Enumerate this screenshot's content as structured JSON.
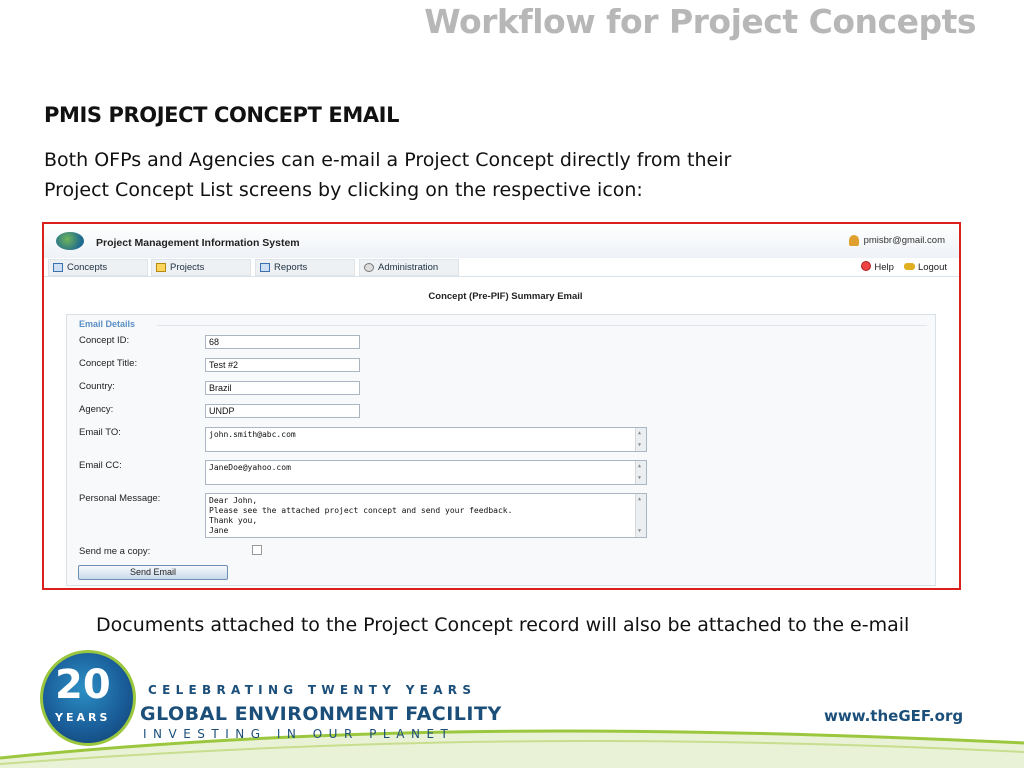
{
  "slide": {
    "title": "Workflow for Project Concepts",
    "heading": "PMIS PROJECT CONCEPT EMAIL",
    "intro_lines": [
      "Both OFPs and Agencies can e-mail a Project Concept directly from their",
      "Project Concept List screens by clicking on the respective icon:"
    ],
    "footer_note": "Documents attached to the Project Concept record will also be attached to the e-mail"
  },
  "app": {
    "title": "Project Management Information System",
    "user_email": "pmisbr@gmail.com",
    "tabs": [
      {
        "label": "Concepts",
        "icon": "concepts-icon"
      },
      {
        "label": "Projects",
        "icon": "projects-icon"
      },
      {
        "label": "Reports",
        "icon": "reports-icon"
      },
      {
        "label": "Administration",
        "icon": "gear-icon"
      }
    ],
    "help_label": "Help",
    "logout_label": "Logout",
    "page_heading": "Concept (Pre-PIF) Summary Email",
    "form": {
      "legend": "Email Details",
      "concept_id": {
        "label": "Concept ID:",
        "value": "68"
      },
      "concept_title": {
        "label": "Concept Title:",
        "value": "Test #2"
      },
      "country": {
        "label": "Country:",
        "value": "Brazil"
      },
      "agency": {
        "label": "Agency:",
        "value": "UNDP"
      },
      "email_to": {
        "label": "Email TO:",
        "value": "john.smith@abc.com"
      },
      "email_cc": {
        "label": "Email CC:",
        "value": "JaneDoe@yahoo.com"
      },
      "personal_message": {
        "label": "Personal Message:",
        "lines": [
          "Dear John,",
          "Please see the attached project concept and send your feedback.",
          "Thank you,",
          "Jane"
        ]
      },
      "send_copy": {
        "label": "Send me a copy:",
        "checked": false
      },
      "send_button": "Send Email"
    }
  },
  "branding": {
    "logo_number": "20",
    "logo_years": "YEARS",
    "tagline_top": "CELEBRATING TWENTY YEARS",
    "name": "GLOBAL ENVIRONMENT FACILITY",
    "tagline_bottom": "INVESTING IN OUR PLANET",
    "url": "www.theGEF.org",
    "colors": {
      "navy": "#1b4f7a",
      "green": "#9bc73e",
      "frame_red": "#d9201c"
    }
  }
}
